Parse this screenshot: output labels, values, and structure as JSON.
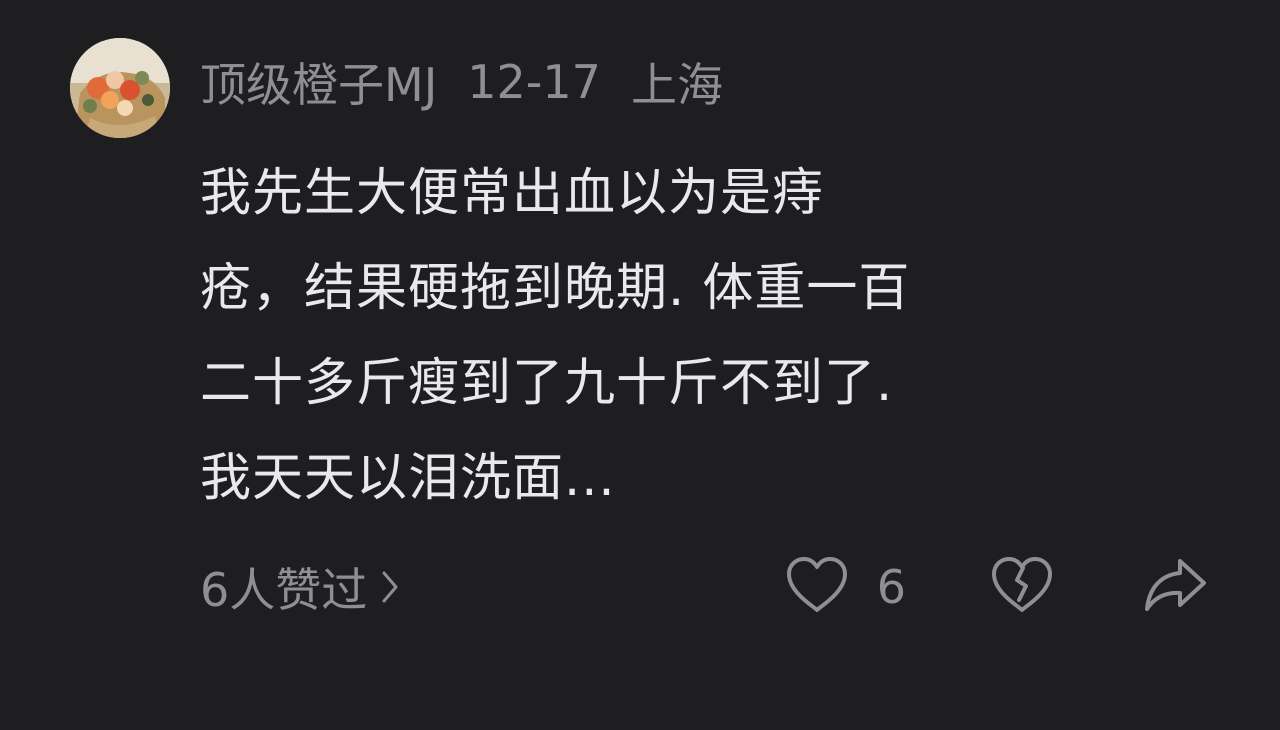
{
  "comment": {
    "author": "顶级橙子MJ",
    "date": "12-17",
    "location": "上海",
    "avatar_icon": "bouquet-avatar",
    "text_lines": [
      "我先生大便常出血以为是痔",
      "疮，结果硬拖到晚期. 体重一百",
      "二十多斤瘦到了九十斤不到了.",
      "我天天以泪洗面..."
    ],
    "likers_label": "6人赞过",
    "likers_icon": "chevron-right-icon",
    "like_count": "6",
    "like_icon": "heart-outline-icon",
    "dislike_icon": "broken-heart-icon",
    "share_icon": "share-arrow-icon"
  },
  "colors": {
    "background": "#1e1e20",
    "primary_text": "#e9e9eb",
    "secondary_text": "#8e8e93"
  }
}
